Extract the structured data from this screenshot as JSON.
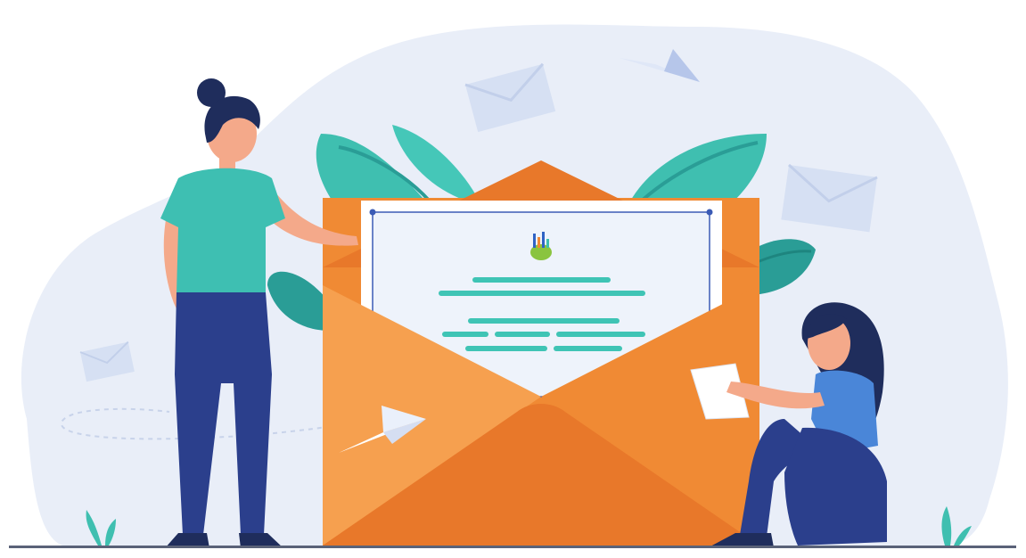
{
  "scene": {
    "description_icons": [
      "paper-plane-icon",
      "envelope-icon",
      "letter-icon",
      "chart-logo-icon",
      "leaf-icon"
    ],
    "colors": {
      "blob": "#e9eef8",
      "envelope_orange": "#f08a34",
      "envelope_dark": "#e8782a",
      "envelope_light": "#f6a04f",
      "leaf_teal": "#3fbfb0",
      "leaf_dark": "#2a9d96",
      "letter_bg": "#eef3fb",
      "letter_lines": "#3fc4b5",
      "shirt_teal": "#3ebfb2",
      "pants_navy": "#2b3f8c",
      "hair_navy": "#1f2d5c",
      "skin": "#f4a98a",
      "shirt_blue": "#4a86d8",
      "ground": "#5a6278"
    }
  }
}
